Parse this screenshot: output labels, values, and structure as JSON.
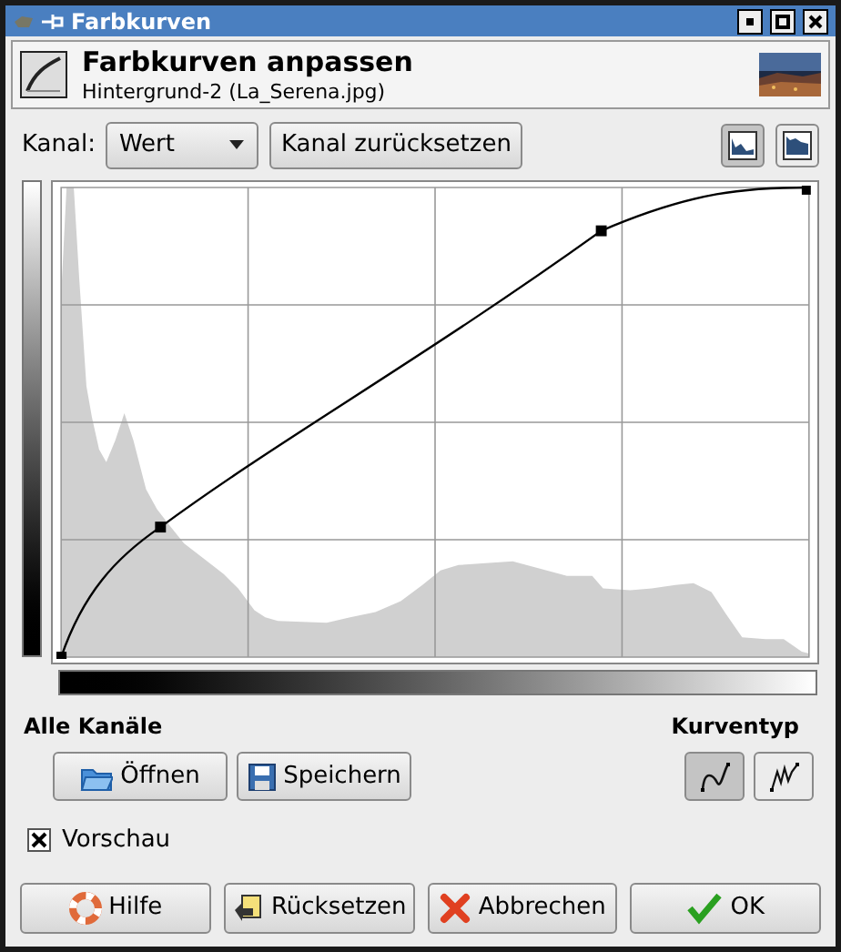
{
  "window": {
    "title": "Farbkurven"
  },
  "header": {
    "title": "Farbkurven anpassen",
    "subtitle": "Hintergrund-2 (La_Serena.jpg)"
  },
  "channel": {
    "label": "Kanal:",
    "value": "Wert",
    "reset_button": "Kanal zurücksetzen"
  },
  "histogram_scale_buttons": [
    {
      "kind": "linear",
      "selected": true
    },
    {
      "kind": "log",
      "selected": false
    }
  ],
  "all_channels": {
    "title": "Alle Kanäle",
    "buttons": [
      {
        "label": "Öffnen",
        "kind": "open"
      },
      {
        "label": "Speichern",
        "kind": "save"
      }
    ]
  },
  "curve_type": {
    "title": "Kurventyp",
    "options": [
      {
        "kind": "smooth",
        "selected": true
      },
      {
        "kind": "freehand",
        "selected": false
      }
    ]
  },
  "preview": {
    "label": "Vorschau",
    "checked": true
  },
  "buttons": [
    {
      "label": "Hilfe",
      "kind": "help"
    },
    {
      "label": "Rücksetzen",
      "kind": "reset"
    },
    {
      "label": "Abbrechen",
      "kind": "cancel"
    },
    {
      "label": "OK",
      "kind": "ok"
    }
  ]
}
